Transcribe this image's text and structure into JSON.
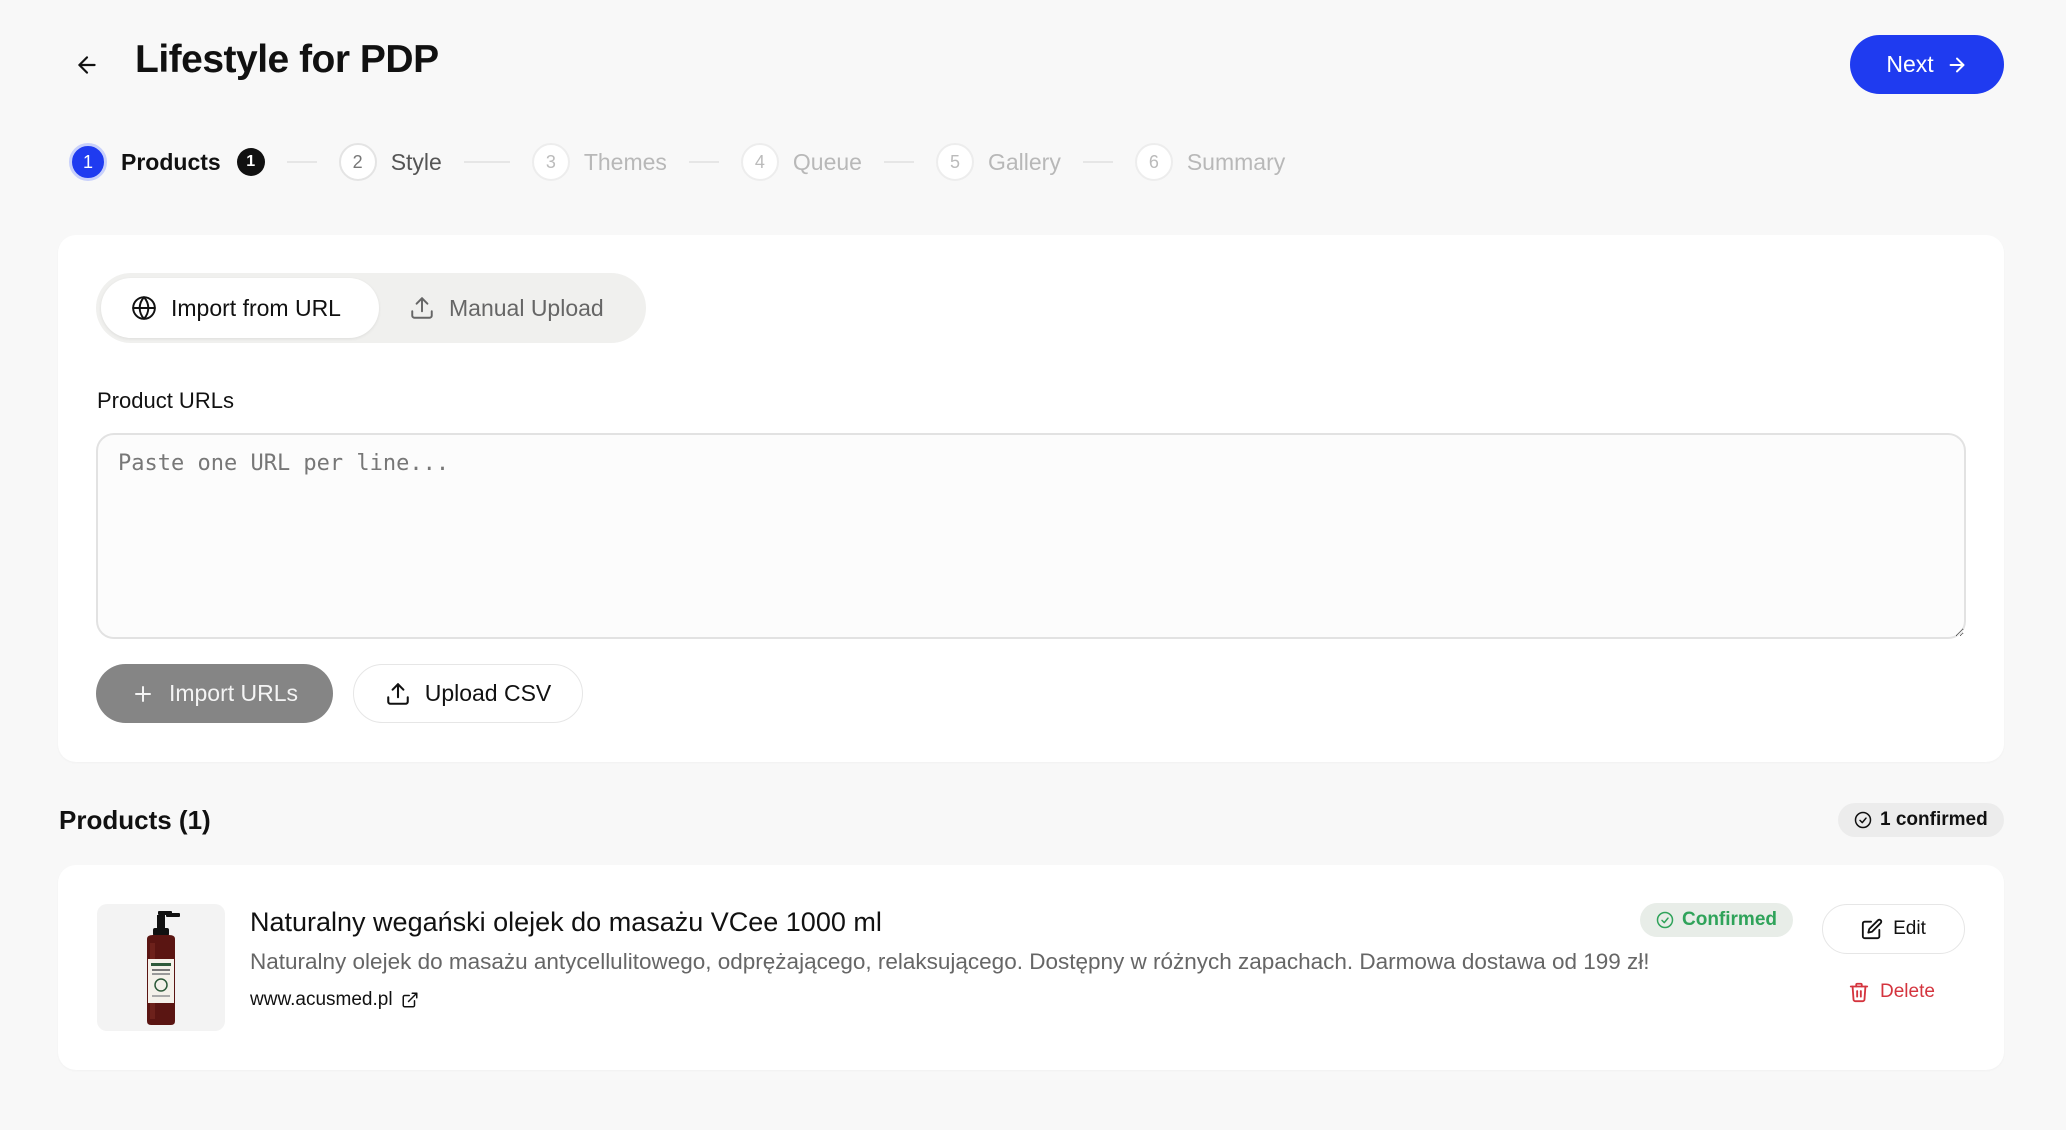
{
  "header": {
    "title": "Lifestyle for PDP",
    "back_icon": "arrow-left-icon",
    "next_label": "Next",
    "next_icon": "arrow-right-icon",
    "accent_color": "#1f3bf0"
  },
  "stepper": {
    "steps": [
      {
        "number": "1",
        "label": "Products",
        "state": "active",
        "badge": "1"
      },
      {
        "number": "2",
        "label": "Style",
        "state": "available"
      },
      {
        "number": "3",
        "label": "Themes",
        "state": "future"
      },
      {
        "number": "4",
        "label": "Queue",
        "state": "future"
      },
      {
        "number": "5",
        "label": "Gallery",
        "state": "future"
      },
      {
        "number": "6",
        "label": "Summary",
        "state": "future"
      }
    ]
  },
  "import": {
    "tabs": [
      {
        "label": "Import from URL",
        "icon": "globe-icon",
        "selected": true
      },
      {
        "label": "Manual Upload",
        "icon": "upload-icon",
        "selected": false
      }
    ],
    "field_label": "Product URLs",
    "textarea_value": "",
    "textarea_placeholder": "Paste one URL per line...",
    "import_urls_label": "Import URLs",
    "upload_csv_label": "Upload CSV"
  },
  "products": {
    "heading": "Products (1)",
    "confirmed_summary": "1 confirmed",
    "items": [
      {
        "title": "Naturalny wegański olejek do masażu VCee 1000 ml",
        "description": "Naturalny olejek do masażu antycellulitowego, odprężającego, relaksującego. Dostępny w różnych zapachach. Darmowa dostawa od 199 zł!",
        "domain": "www.acusmed.pl",
        "status": "Confirmed",
        "status_color": "#2fa35a",
        "edit_label": "Edit",
        "delete_label": "Delete",
        "delete_color": "#d4343e"
      }
    ]
  }
}
